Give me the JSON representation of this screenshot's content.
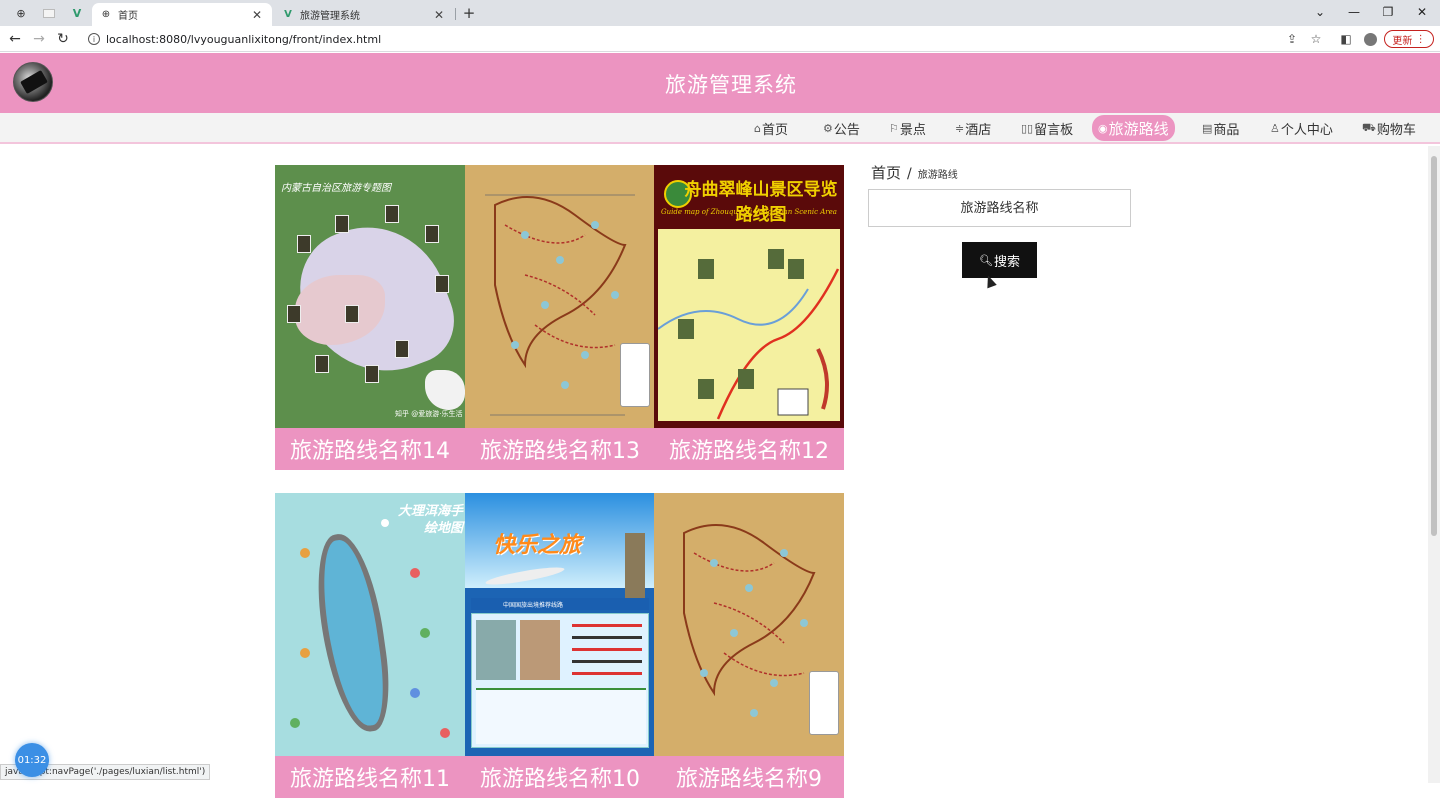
{
  "browser": {
    "tabs": [
      {
        "title": "首页",
        "icon": "globe-icon",
        "active": true
      },
      {
        "title": "旅游管理系统",
        "icon": "vue-icon",
        "active": false
      }
    ],
    "url": "localhost:8080/lvyouguanlixitong/front/index.html",
    "update_label": "更新"
  },
  "site": {
    "title": "旅游管理系统",
    "nav": [
      {
        "label": "首页",
        "icon": "⌂"
      },
      {
        "label": "公告",
        "icon": "⚙"
      },
      {
        "label": "景点",
        "icon": "⚐"
      },
      {
        "label": "酒店",
        "icon": "≑"
      },
      {
        "label": "留言板",
        "icon": "▯▯"
      },
      {
        "label": "旅游路线",
        "icon": "◉",
        "active": true
      },
      {
        "label": "商品",
        "icon": "▤"
      },
      {
        "label": "个人中心",
        "icon": "♙"
      },
      {
        "label": "购物车",
        "icon": "⛟"
      }
    ]
  },
  "routes": [
    {
      "name": "旅游路线名称14"
    },
    {
      "name": "旅游路线名称13"
    },
    {
      "name": "旅游路线名称12"
    },
    {
      "name": "旅游路线名称11"
    },
    {
      "name": "旅游路线名称10"
    },
    {
      "name": "旅游路线名称9"
    }
  ],
  "thumb_text": {
    "map14_title": "内蒙古自治区旅游专题图",
    "map14_watermark": "知乎 @爱旅游·乐生活",
    "map12_title": "舟曲翠峰山景区导览路线图",
    "map12_subtitle": "Guide map of Zhouqu Cui Feng Shan Scenic Area",
    "map11_title": "大理洱海手绘地图",
    "map10_title": "快乐之旅",
    "map10_bar": "中国国旅出境推荐线路"
  },
  "sidebar": {
    "breadcrumb_home": "首页",
    "breadcrumb_sep": "/",
    "breadcrumb_current": "旅游路线",
    "search_placeholder": "旅游路线名称",
    "search_button": "搜索"
  },
  "status_url": "javascript:navPage('./pages/luxian/list.html')",
  "timer": "01:32",
  "colors": {
    "brand_pink": "#ec94c1",
    "search_button": "#111111"
  }
}
